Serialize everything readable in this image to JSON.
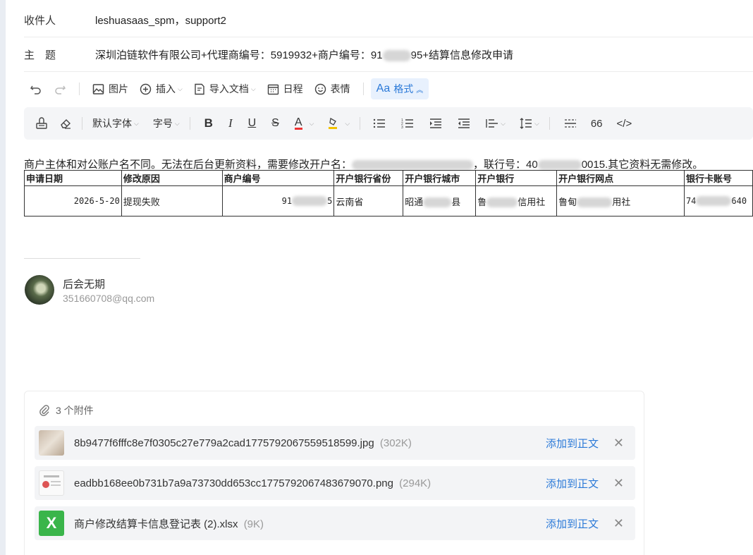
{
  "recipients": {
    "label": "收件人",
    "value": "leshuasaas_spm，support2"
  },
  "subject": {
    "label": "主　题",
    "value_pre": "深圳泊链软件有限公司+代理商编号：5919932+商户编号：91",
    "value_post": "95+结算信息修改申请"
  },
  "toolbar": {
    "undo_icon": "undo-icon",
    "redo_icon": "redo-icon",
    "image_label": "图片",
    "insert_label": "插入",
    "import_label": "导入文档",
    "calendar_label": "日程",
    "emoji_label": "表情",
    "format_label": "格式",
    "format_icon_text": "Aa"
  },
  "format_bar": {
    "font_label": "默认字体",
    "size_label": "字号",
    "quote_label": "66"
  },
  "body": {
    "text_pre": "商户主体和对公账户名不同。无法在后台更新资料，需要修改开户名：",
    "text_mid": "，联行号：40",
    "text_post": "0015.其它资料无需修改。"
  },
  "table": {
    "headers": [
      "申请日期",
      "修改原因",
      "商户编号",
      "开户银行省份",
      "开户银行城市",
      "开户银行",
      "开户银行网点",
      "银行卡账号"
    ],
    "row": {
      "date": "2026-5-20",
      "reason": "提现失败",
      "merchant_no_a": "91",
      "merchant_no_b": "5",
      "province": "云南省",
      "city_a": "昭通",
      "city_b": "县",
      "bank_a": "鲁",
      "bank_b": "信用社",
      "branch_a": "鲁甸",
      "branch_b": "用社",
      "card_a": "74",
      "card_b": "640"
    }
  },
  "signature": {
    "name": "后会无期",
    "email": "351660708@qq.com"
  },
  "attachments": {
    "count_label": "3 个附件",
    "add_label": "添加到正文",
    "items": [
      {
        "name": "8b9477f6fffc8e7f0305c27e779a2cad1775792067559518599.jpg",
        "size": "(302K)",
        "icon": "image-thumbnail"
      },
      {
        "name": "eadbb168ee0b731b7a9a73730dd653cc1775792067483679070.png",
        "size": "(294K)",
        "icon": "image-thumbnail"
      },
      {
        "name": "商户修改结算卡信息登记表 (2).xlsx",
        "size": "(9K)",
        "icon": "excel-icon"
      }
    ]
  },
  "colors": {
    "accent": "#2a79d8",
    "excel": "#3ab54a"
  }
}
